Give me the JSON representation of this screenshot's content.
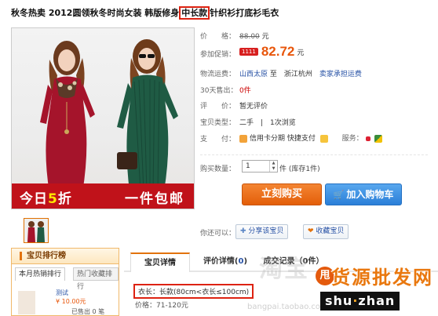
{
  "product": {
    "title_before": "秋冬热卖 2012圆领秋冬时尚女装 韩版修身",
    "title_highlight": "中长款",
    "title_after": "针织衫打底衫毛衣"
  },
  "banner": {
    "left_prefix": "今日",
    "left_num": "5",
    "left_suffix": "折",
    "right": "一件包邮"
  },
  "info": {
    "price_label": "价　　格：",
    "price_value": "88.00",
    "price_unit": "元",
    "promo_label": "参加促销：",
    "promo_tag": "1111",
    "promo_price": "82.72",
    "promo_unit": "元",
    "shipping_label": "物流运费：",
    "shipping_from": "山西太原",
    "shipping_to": "至　浙江杭州",
    "shipping_fee": "卖家承担运费",
    "sold_label": "30天售出：",
    "sold_value": "0件",
    "rating_label": "评　　价：",
    "rating_value": "暂无评价",
    "type_label": "宝贝类型：",
    "type_value": "二手　|　1次浏览",
    "pay_label": "支　　付：",
    "pay_credit": "信用卡分期",
    "pay_quick": "快捷支付",
    "service_label": "服务："
  },
  "purchase": {
    "qty_label": "购买数量：",
    "qty_value": "1",
    "qty_stock": "件 (库存1件)",
    "buy_label": "立刻购买",
    "cart_label": "加入购物车"
  },
  "social": {
    "label": "你还可以：",
    "share": "分享该宝贝",
    "fav": "收藏宝贝"
  },
  "rank": {
    "header": "宝贝排行榜",
    "tab1": "本月热销排行",
    "tab2": "热门收藏排行",
    "item_title": "测试",
    "item_price": "¥ 10.00元",
    "item_sold": "已售出 0 笔"
  },
  "tabs": {
    "detail": "宝贝详情",
    "review_prefix": "评价详情(",
    "review_count": "0",
    "review_suffix": ")",
    "trade": "成交记录（0件）"
  },
  "detail": {
    "size": "衣长：长款(80cm<衣长≤100cm)",
    "price_range": "价格：71-120元"
  },
  "watermark": {
    "main": "淘宝",
    "url": "bangpai.taobao.com"
  },
  "logo": {
    "badge": "甩",
    "cn": "货源批发网",
    "en_a": "shu",
    "en_dot": "·",
    "en_b": "zhan"
  },
  "colors": {
    "accent_orange": "#e8560b",
    "buy_button": "#f48533",
    "cart_button": "#2b7fd8",
    "highlight_red": "#dd2211"
  }
}
